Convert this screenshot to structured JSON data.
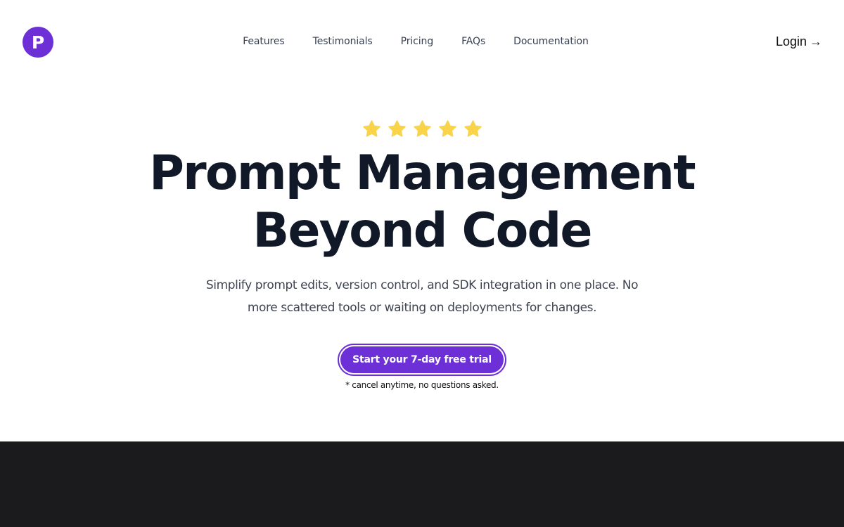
{
  "header": {
    "logo_letter": "P",
    "nav": [
      {
        "label": "Features"
      },
      {
        "label": "Testimonials"
      },
      {
        "label": "Pricing"
      },
      {
        "label": "FAQs"
      },
      {
        "label": "Documentation"
      }
    ],
    "login_label": "Login",
    "login_arrow": "→"
  },
  "hero": {
    "rating": {
      "stars_filled": 5,
      "stars_total": 5,
      "color": "#f9d44a",
      "icon": "star-icon"
    },
    "headline_line1": "Prompt Management",
    "headline_line2": "Beyond Code",
    "subtitle": "Simplify prompt edits, version control, and SDK integration in one place. No more scattered tools or waiting on deployments for changes.",
    "cta_label": "Start your 7-day free trial",
    "cta_note": "* cancel anytime, no questions asked."
  },
  "colors": {
    "brand": "#6d2fd6",
    "headline": "#111827",
    "dark_section": "#1b1b1d"
  }
}
